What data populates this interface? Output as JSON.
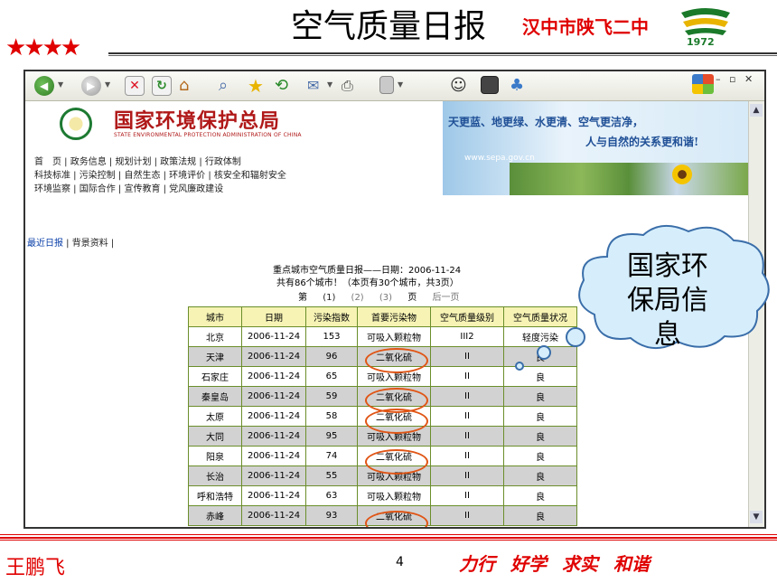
{
  "slide": {
    "title": "空气质量日报",
    "school_name": "汉中市陕飞二中",
    "logo_year": "1972",
    "stars": "★★★★",
    "author": "王鹏飞",
    "page_number": "4",
    "motto": "力行 好学 求实 和谐",
    "callout_text": "国家环保局信息"
  },
  "browser": {
    "toolbar": {
      "back_arrow": "◀",
      "forward_arrow": "▶",
      "dropdown_glyph": "▼",
      "stop_glyph": "✕",
      "refresh_glyph": "↻",
      "home_glyph": "⌂",
      "search_glyph": "⌕",
      "favorites_glyph": "★",
      "history_glyph": "⟲",
      "mail_glyph": "✉",
      "print_glyph": "⎙",
      "messenger_glyph": "☺",
      "discuss_glyph": "♣",
      "window_controls": "– ▫ ✕"
    }
  },
  "site": {
    "agency_name": "国家环境保护总局",
    "agency_name_en": "STATE ENVIRONMENTAL PROTECTION ADMINISTRATION OF CHINA",
    "slogan_line1": "天更蓝、地更绿、水更清、空气更洁净，",
    "slogan_line2": "人与自然的关系更和谐!",
    "url": "www.sepa.gov.cn",
    "nav_line1": "首　页 | 政务信息 | 规划计划 | 政策法规 | 行政体制",
    "nav_line2": "科技标准 | 污染控制 | 自然生态 | 环境评价 | 核安全和辐射安全",
    "nav_line3": "环境监察 | 国际合作 | 宣传教育 | 党风廉政建设",
    "tabs": {
      "latest": "最近日报",
      "separator": " | ",
      "background": "背景资料 |"
    }
  },
  "report": {
    "title": "重点城市空气质量日报——日期：2006-11-24",
    "count": "共有86个城市！（本页有30个城市，共3页）",
    "pager": {
      "prefix": "第",
      "page1": "(1)",
      "page2": "(2)",
      "page3": "(3)",
      "suffix": "页",
      "next": "后一页"
    },
    "headers": {
      "city": "城市",
      "date": "日期",
      "index": "污染指数",
      "pollutant": "首要污染物",
      "level": "空气质量级别",
      "status": "空气质量状况"
    },
    "rows": [
      {
        "city": "北京",
        "date": "2006-11-24",
        "index": "153",
        "pollutant": "可吸入颗粒物",
        "level": "III2",
        "status": "轻度污染"
      },
      {
        "city": "天津",
        "date": "2006-11-24",
        "index": "96",
        "pollutant": "二氧化硫",
        "level": "II",
        "status": "良"
      },
      {
        "city": "石家庄",
        "date": "2006-11-24",
        "index": "65",
        "pollutant": "可吸入颗粒物",
        "level": "II",
        "status": "良"
      },
      {
        "city": "秦皇岛",
        "date": "2006-11-24",
        "index": "59",
        "pollutant": "二氧化硫",
        "level": "II",
        "status": "良"
      },
      {
        "city": "太原",
        "date": "2006-11-24",
        "index": "58",
        "pollutant": "二氧化硫",
        "level": "II",
        "status": "良"
      },
      {
        "city": "大同",
        "date": "2006-11-24",
        "index": "95",
        "pollutant": "可吸入颗粒物",
        "level": "II",
        "status": "良"
      },
      {
        "city": "阳泉",
        "date": "2006-11-24",
        "index": "74",
        "pollutant": "二氧化硫",
        "level": "II",
        "status": "良"
      },
      {
        "city": "长治",
        "date": "2006-11-24",
        "index": "55",
        "pollutant": "可吸入颗粒物",
        "level": "II",
        "status": "良"
      },
      {
        "city": "呼和浩特",
        "date": "2006-11-24",
        "index": "63",
        "pollutant": "可吸入颗粒物",
        "level": "II",
        "status": "良"
      },
      {
        "city": "赤峰",
        "date": "2006-11-24",
        "index": "93",
        "pollutant": "二氧化硫",
        "level": "II",
        "status": "良"
      }
    ]
  },
  "colors": {
    "accent_red": "#e00000",
    "table_header_bg": "#f6f3b4",
    "table_border": "#6b8e2b",
    "highlight_ring": "#e05515",
    "link_blue": "#0a3fa8"
  }
}
